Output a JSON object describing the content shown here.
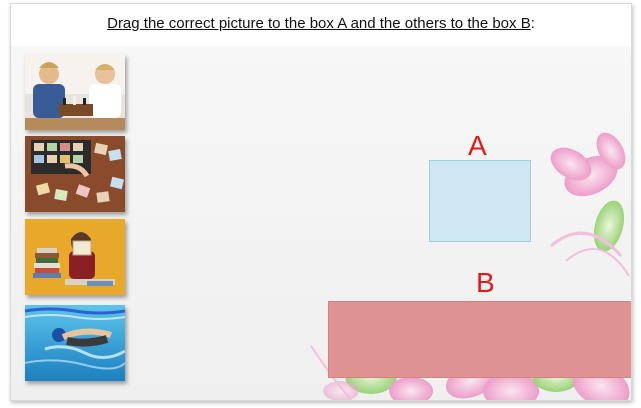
{
  "instruction": {
    "part1": "Drag the correct picture to the box A and the others to the box B",
    "punct": ":"
  },
  "targets": {
    "a_label": "A",
    "b_label": "B"
  },
  "pictures": [
    {
      "icon": "boys-playing-chess-photo"
    },
    {
      "icon": "stamp-collection-photo"
    },
    {
      "icon": "woman-reading-books-photo"
    },
    {
      "icon": "swimmer-photo"
    }
  ],
  "colors": {
    "label": "#e11a1a",
    "box_a": "#cfe7f2",
    "box_b": "#de9292",
    "decor_pink": "#f2a6d0",
    "decor_green": "#a8d982"
  }
}
